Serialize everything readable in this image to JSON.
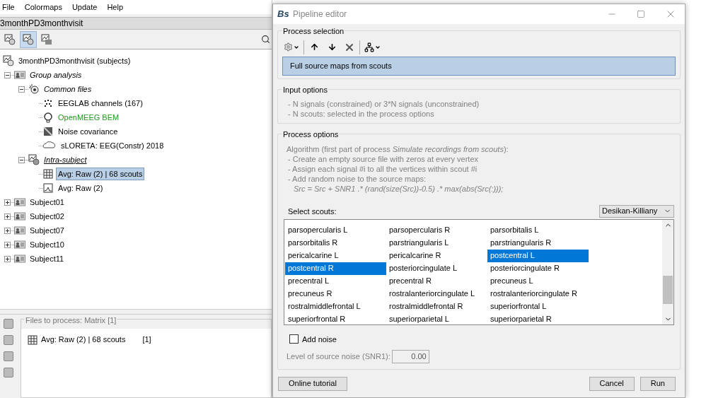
{
  "menu": [
    "File",
    "Colormaps",
    "Update",
    "Help"
  ],
  "protocol_title": "3monthPD3monthvisit",
  "view_tabs": [
    {
      "kind": "functional",
      "selected": false
    },
    {
      "kind": "subjects",
      "selected": true
    },
    {
      "kind": "conditions",
      "selected": false
    }
  ],
  "tree": [
    {
      "label": "3monthPD3monthvisit (subjects)",
      "kind": "protocol",
      "selected": false,
      "default": false,
      "expanded": true,
      "children": [
        {
          "label": "Group analysis",
          "kind": "group",
          "selected": false,
          "default": false,
          "expanded": true,
          "children": [
            {
              "label": "Common files",
              "kind": "common",
              "selected": false,
              "default": false,
              "expanded": true,
              "children": [
                {
                  "label": "EEGLAB channels (167)",
                  "kind": "channel",
                  "selected": false,
                  "default": false
                },
                {
                  "label": "OpenMEEG BEM",
                  "kind": "headmodel",
                  "selected": false,
                  "default": true
                },
                {
                  "label": "Noise covariance",
                  "kind": "noise",
                  "selected": false,
                  "default": false
                },
                {
                  "label": "sLORETA: EEG(Constr) 2018",
                  "kind": "sources",
                  "selected": false,
                  "default": false
                }
              ]
            },
            {
              "label": "Intra-subject",
              "kind": "intra",
              "selected": false,
              "default": false,
              "expanded": true,
              "children": [
                {
                  "label": "Avg: Raw (2) | 68 scouts",
                  "kind": "matrix",
                  "selected": true,
                  "default": false
                },
                {
                  "label": "Avg: Raw (2)",
                  "kind": "timeseries",
                  "selected": false,
                  "default": false
                }
              ]
            }
          ]
        },
        {
          "label": "Subject01",
          "kind": "subject",
          "selected": false,
          "default": false,
          "expanded": false
        },
        {
          "label": "Subject02",
          "kind": "subject",
          "selected": false,
          "default": false,
          "expanded": false
        },
        {
          "label": "Subject07",
          "kind": "subject",
          "selected": false,
          "default": false,
          "expanded": false
        },
        {
          "label": "Subject10",
          "kind": "subject",
          "selected": false,
          "default": false,
          "expanded": false
        },
        {
          "label": "Subject11",
          "kind": "subject",
          "selected": false,
          "default": false,
          "expanded": false
        }
      ]
    }
  ],
  "files_panel": {
    "title": "Files to process: Matrix [1]",
    "files": [
      {
        "label": "Avg: Raw (2) | 68 scouts",
        "count": "[1]"
      }
    ]
  },
  "dialog": {
    "title": "Pipeline editor",
    "logo": "Bs",
    "process_selection": {
      "title": "Process selection",
      "processes": [
        {
          "label": "Full source maps from scouts",
          "selected": true
        }
      ]
    },
    "input_options": {
      "title": "Input options",
      "lines": [
        "- N signals (constrained) or 3*N signals (unconstrained)",
        "- N scouts: selected in the process options"
      ]
    },
    "process_options": {
      "title": "Process options",
      "algorithm": [
        {
          "kind": "text",
          "text": "Algorithm (first part of process *Simulate recordings from scouts*):"
        },
        {
          "kind": "text",
          "text": "- Create an empty source file with zeros at every vertex"
        },
        {
          "kind": "text",
          "text": "- Assign each signal #i to all the vertices within scout #i"
        },
        {
          "kind": "text",
          "text": "- Add random noise to the source maps:"
        },
        {
          "kind": "formula",
          "text": "Src = Src + SNR1 .* (rand(size(Src))-0.5) .* max(abs(Src(:)));"
        }
      ],
      "scouts_label": "Select scouts:",
      "atlas": "Desikan-Killiany",
      "scouts": [
        {
          "label": "parsopercularis L",
          "selected": false
        },
        {
          "label": "parsopercularis R",
          "selected": false
        },
        {
          "label": "parsorbitalis L",
          "selected": false
        },
        {
          "label": "parsorbitalis R",
          "selected": false
        },
        {
          "label": "parstriangularis L",
          "selected": false
        },
        {
          "label": "parstriangularis R",
          "selected": false
        },
        {
          "label": "pericalcarine L",
          "selected": false
        },
        {
          "label": "pericalcarine R",
          "selected": false
        },
        {
          "label": "postcentral L",
          "selected": true
        },
        {
          "label": "postcentral R",
          "selected": true
        },
        {
          "label": "posteriorcingulate L",
          "selected": false
        },
        {
          "label": "posteriorcingulate R",
          "selected": false
        },
        {
          "label": "precentral L",
          "selected": false
        },
        {
          "label": "precentral R",
          "selected": false
        },
        {
          "label": "precuneus L",
          "selected": false
        },
        {
          "label": "precuneus R",
          "selected": false
        },
        {
          "label": "rostralanteriorcingulate L",
          "selected": false
        },
        {
          "label": "rostralanteriorcingulate R",
          "selected": false
        },
        {
          "label": "rostralmiddlefrontal L",
          "selected": false
        },
        {
          "label": "rostralmiddlefrontal R",
          "selected": false
        },
        {
          "label": "superiorfrontal L",
          "selected": false
        },
        {
          "label": "superiorfrontal R",
          "selected": false
        },
        {
          "label": "superiorparietal L",
          "selected": false
        },
        {
          "label": "superiorparietal R",
          "selected": false
        }
      ],
      "add_noise": {
        "label": "Add noise",
        "checked": false
      },
      "noise_level": {
        "label": "Level of source noise (SNR1):",
        "value": "0.00",
        "disabled": true
      }
    },
    "buttons": {
      "left": "Online tutorial",
      "right": [
        "Cancel",
        "Run"
      ]
    }
  }
}
